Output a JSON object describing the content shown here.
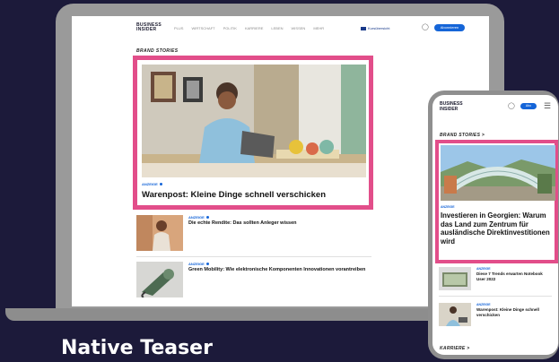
{
  "laptop": {
    "nav": {
      "logo_line1": "BUSINESS",
      "logo_line2": "INSIDER",
      "links": [
        "PLUS",
        "WIRTSCHAFT",
        "POLITIK",
        "KARRIERE",
        "LEBEN",
        "WISSEN",
        "MEHR"
      ],
      "stock_label": "Kursübersicht",
      "user_icon": "user-icon",
      "abo_label": "Abonnieren"
    },
    "brand_stories": "BRAND STORIES",
    "hero": {
      "anzeige": "ANZEIGE",
      "title": "Warenpost: Kleine Dinge schnell verschicken"
    },
    "articles": [
      {
        "anzeige": "ANZEIGE",
        "title": "Die echte Rendite: Das sollten Anleger wissen"
      },
      {
        "anzeige": "ANZEIGE",
        "title": "Green Mobility: Wie elektronische Komponenten Innovationen vorantreiben"
      }
    ]
  },
  "phone": {
    "logo_line1": "BUSINESS",
    "logo_line2": "INSIDER",
    "user_icon": "user-icon",
    "abo_label": "Abo",
    "menu_icon": "menu-icon",
    "brand_stories": "BRAND STORIES >",
    "hero": {
      "anzeige": "ANZEIGE",
      "title": "Investieren in Georgien: Warum das Land zum Zentrum für ausländische Direktinvestitionen wird"
    },
    "articles": [
      {
        "anzeige": "ANZEIGE",
        "title": "Diese 7 Trends erwarten Notebook User 2022"
      },
      {
        "anzeige": "ANZEIGE",
        "title": "Warenpost: Kleine Dinge schnell verschicken"
      }
    ],
    "karriere": "KARRIERE >"
  },
  "caption": "Native Teaser",
  "colors": {
    "background": "#1c1a3a",
    "highlight": "#e24e8a",
    "accent_blue": "#1565d8"
  }
}
